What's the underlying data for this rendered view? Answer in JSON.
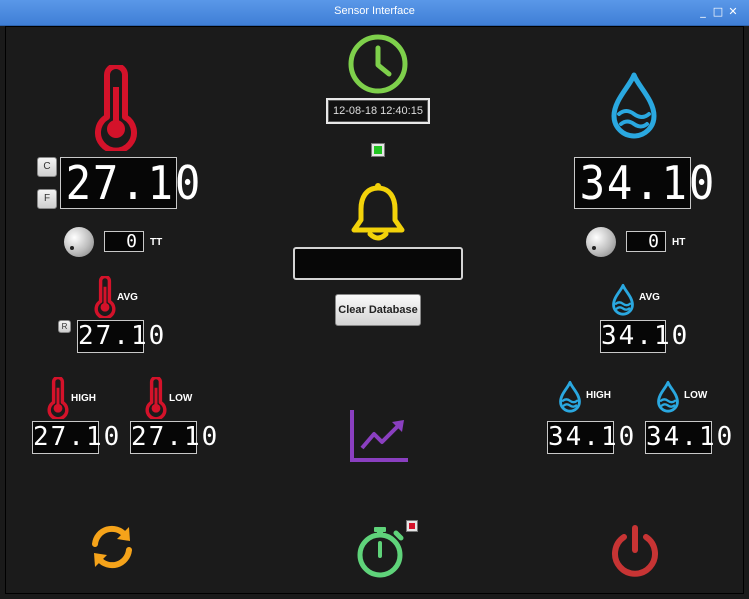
{
  "window": {
    "title": "Sensor Interface",
    "minimize": "_",
    "maximize": "□",
    "close": "✕"
  },
  "clock": {
    "datetime": "12-08-18  12:40:15"
  },
  "temperature": {
    "current": "27.10",
    "unit_c": "C",
    "unit_f": "F",
    "threshold_value": "0",
    "threshold_label": "TT",
    "avg_label": "AVG",
    "avg_value": "27.10",
    "reset_label": "R",
    "high_label": "HIGH",
    "high_value": "27.10",
    "low_label": "LOW",
    "low_value": "27.10"
  },
  "humidity": {
    "current": "34.10",
    "threshold_value": "0",
    "threshold_label": "HT",
    "avg_label": "AVG",
    "avg_value": "34.10",
    "high_label": "HIGH",
    "high_value": "34.10",
    "low_label": "LOW",
    "low_value": "34.10"
  },
  "alarm": {
    "message": ""
  },
  "buttons": {
    "clear_database": "Clear Database"
  },
  "colors": {
    "temp_red": "#d4122a",
    "humidity_blue": "#2aa8e0",
    "clock_green": "#7ed04b",
    "bell_yellow": "#f2d20a",
    "chart_purple": "#8a3fc0",
    "refresh_orange": "#f5a31a",
    "timer_green": "#5fd37a",
    "power_red": "#c73434",
    "status_led": "#22c422"
  }
}
